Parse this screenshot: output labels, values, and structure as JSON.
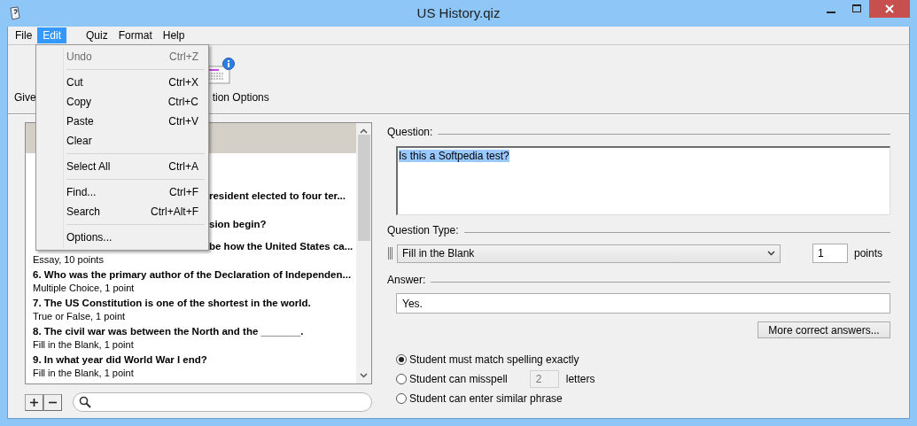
{
  "window": {
    "title": "US History.qiz"
  },
  "menu_bar": [
    {
      "label": "File",
      "selected": false
    },
    {
      "label": "Edit",
      "selected": true
    },
    {
      "label": "Quiz",
      "selected": false
    },
    {
      "label": "Format",
      "selected": false
    },
    {
      "label": "Help",
      "selected": false
    }
  ],
  "edit_menu": [
    {
      "kind": "item",
      "label": "Undo",
      "shortcut": "Ctrl+Z",
      "disabled": true
    },
    {
      "kind": "separator"
    },
    {
      "kind": "item",
      "label": "Cut",
      "shortcut": "Ctrl+X",
      "disabled": false
    },
    {
      "kind": "item",
      "label": "Copy",
      "shortcut": "Ctrl+C",
      "disabled": false
    },
    {
      "kind": "item",
      "label": "Paste",
      "shortcut": "Ctrl+V",
      "disabled": false
    },
    {
      "kind": "item",
      "label": "Clear",
      "disabled": false
    },
    {
      "kind": "separator"
    },
    {
      "kind": "item",
      "label": "Select All",
      "shortcut": "Ctrl+A",
      "disabled": false
    },
    {
      "kind": "separator"
    },
    {
      "kind": "item",
      "label": "Find...",
      "shortcut": "Ctrl+F",
      "disabled": false
    },
    {
      "kind": "item",
      "label": "Search",
      "shortcut": "Ctrl+Alt+F",
      "disabled": false
    },
    {
      "kind": "separator"
    },
    {
      "kind": "item",
      "label": "Options...",
      "disabled": false
    }
  ],
  "toolbar": [
    {
      "label": "Give"
    },
    {
      "label": "tion Options"
    }
  ],
  "question_list": {
    "items": [
      {
        "kind": "covered",
        "selected": true
      },
      {
        "kind": "covered",
        "selected": false
      },
      {
        "kind": "covered",
        "title": "resident elected to four ter...",
        "selected": false
      },
      {
        "kind": "covered",
        "title": "sion begin?",
        "selected": false
      },
      {
        "kind": "covered",
        "title": "be how the United States ca...",
        "subtitle": "Essay, 10 points",
        "selected": false
      },
      {
        "kind": "full",
        "title": "6. Who was the primary author of the Declaration of Independen...",
        "subtitle": "Multiple Choice, 1 point",
        "selected": false
      },
      {
        "kind": "full",
        "title": "7. The US Constitution is one of the shortest in the world.",
        "subtitle": "True or False, 1 point",
        "selected": false
      },
      {
        "kind": "full",
        "title": "8. The civil war was between the North and the _______.",
        "subtitle": "Fill in the Blank, 1 point",
        "selected": false
      },
      {
        "kind": "full",
        "title": "9. In what year did World War I end?",
        "subtitle": "Fill in the Blank, 1 point",
        "selected": false
      }
    ]
  },
  "editor": {
    "question_label": "Question:",
    "question": "Is this a Softpedia test?",
    "question_type_label": "Question Type:",
    "question_type": "Fill in the Blank",
    "points": "1",
    "points_label": "points",
    "answer_label": "Answer:",
    "answer": "Yes.",
    "more_button": "More correct answers...",
    "options": [
      {
        "label": "Student must match spelling exactly",
        "selected": true
      },
      {
        "label": "Student can misspell",
        "selected": false,
        "count": {
          "value": "2",
          "disabled": true
        },
        "suffix": "letters"
      },
      {
        "label": "Student can enter similar phrase",
        "selected": false
      }
    ]
  }
}
